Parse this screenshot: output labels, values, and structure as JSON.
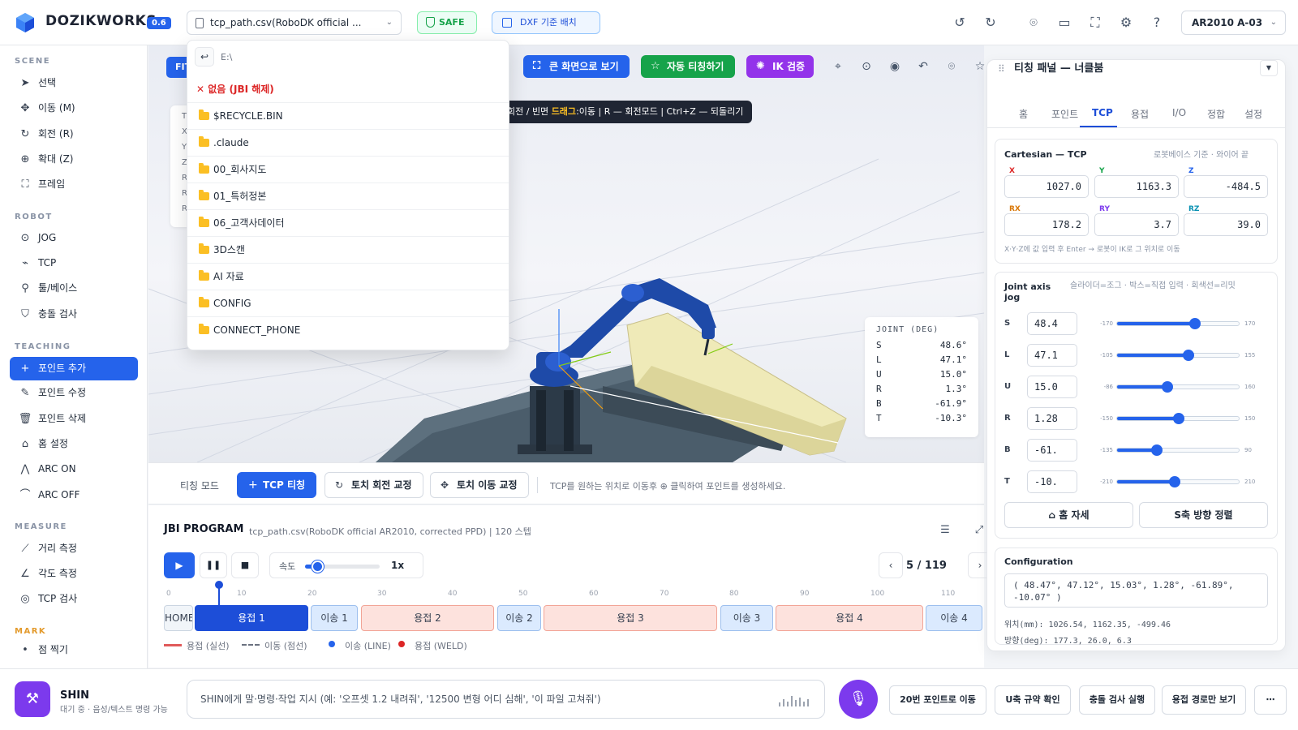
{
  "app": {
    "brand": "DOZIKWORKS",
    "version": "0.6"
  },
  "topbar": {
    "file_name": "tcp_path.csv(RoboDK official ...",
    "safe_label": "SAFE",
    "dxf_label": "DXF 기준 배치",
    "robot_model": "AR2010 A-03"
  },
  "sidebar": {
    "sections": {
      "scene": "SCENE",
      "robot": "ROBOT",
      "teaching": "TEACHING",
      "measure": "MEASURE",
      "mark": "MARK"
    },
    "scene": [
      {
        "label": "선택",
        "icon": "cursor-icon"
      },
      {
        "label": "이동 (M)",
        "icon": "move-icon"
      },
      {
        "label": "회전 (R)",
        "icon": "rotate-icon"
      },
      {
        "label": "확대 (Z)",
        "icon": "zoom-icon"
      },
      {
        "label": "프레임",
        "icon": "frame-icon"
      }
    ],
    "robot": [
      {
        "label": "JOG",
        "icon": "jog-icon"
      },
      {
        "label": "TCP",
        "icon": "tcp-icon"
      },
      {
        "label": "툴/베이스",
        "icon": "wrench-icon"
      },
      {
        "label": "충돌 검사",
        "icon": "shield-icon"
      }
    ],
    "teaching": [
      {
        "label": "포인트 추가",
        "icon": "plus-icon"
      },
      {
        "label": "포인트 수정",
        "icon": "edit-icon"
      },
      {
        "label": "포인트 삭제",
        "icon": "trash-icon"
      },
      {
        "label": "홈 설정",
        "icon": "home-icon"
      },
      {
        "label": "ARC ON",
        "icon": "arc-on-icon"
      },
      {
        "label": "ARC OFF",
        "icon": "arc-off-icon"
      }
    ],
    "measure": [
      {
        "label": "거리 측정",
        "icon": "ruler-icon"
      },
      {
        "label": "각도 측정",
        "icon": "angle-icon"
      },
      {
        "label": "TCP 검사",
        "icon": "target-icon"
      }
    ],
    "mark": [
      {
        "label": "점 찍기",
        "icon": "dot-icon"
      }
    ]
  },
  "viewport": {
    "fit_label": "FIT",
    "fullscreen_label": "큰 화면으로 보기",
    "auto_teach_label": "자동 티칭하기",
    "ik_label": "IK 검증",
    "hint_prefix": "회전 / 빈면 ",
    "hint_bold": "드래그",
    "hint_suffix": ":이동 | R — 회전모드 | Ctrl+Z — 되돌리기",
    "info_labels": [
      "T",
      "X",
      "Y",
      "Z",
      "R",
      "R",
      "R"
    ],
    "joint_title": "JOINT (DEG)",
    "joints": [
      {
        "axis": "S",
        "value": "48.6°"
      },
      {
        "axis": "L",
        "value": "47.1°"
      },
      {
        "axis": "U",
        "value": "15.0°"
      },
      {
        "axis": "R",
        "value": "1.3°"
      },
      {
        "axis": "B",
        "value": "-61.9°"
      },
      {
        "axis": "T",
        "value": "-10.3°"
      }
    ]
  },
  "teachbar": {
    "mode_label": "티칭 모드",
    "tcp_teach": "TCP 티칭",
    "torch_rot": "토치 회전 교정",
    "torch_move": "토치 이동 교정",
    "hint": "TCP를 원하는 위치로 이동후 ⊕ 클릭하여 포인트를 생성하세요."
  },
  "jbi": {
    "title": "JBI PROGRAM",
    "subtitle": "tcp_path.csv(RoboDK official AR2010, corrected PPD) | 120 스텝",
    "speed_label": "속도",
    "speed_value": "1x",
    "speed_fraction": 0.16,
    "page": "5 / 119",
    "ticks": [
      "0",
      "10",
      "20",
      "30",
      "40",
      "50",
      "60",
      "70",
      "80",
      "90",
      "100",
      "110"
    ],
    "segments": [
      {
        "label": "HOME",
        "kind": "home"
      },
      {
        "label": "용접 1",
        "kind": "weld-active"
      },
      {
        "label": "이송 1",
        "kind": "move"
      },
      {
        "label": "용접 2",
        "kind": "weld"
      },
      {
        "label": "이송 2",
        "kind": "move"
      },
      {
        "label": "용접 3",
        "kind": "weld"
      },
      {
        "label": "이송 3",
        "kind": "move"
      },
      {
        "label": "용접 4",
        "kind": "weld"
      },
      {
        "label": "이송 4",
        "kind": "move"
      }
    ],
    "legend": [
      {
        "label": "용접 (실선)",
        "color": "#e05a5a"
      },
      {
        "label": "이동 (점선)",
        "color": "#6b7280"
      },
      {
        "label": "이송 (LINE)",
        "color": "#2563eb"
      },
      {
        "label": "용접 (WELD)",
        "color": "#dc2626"
      }
    ]
  },
  "panel": {
    "title": "티칭 패널 — 너클붐",
    "tabs": [
      "홈",
      "포인트",
      "TCP",
      "용접",
      "I/O",
      "정합",
      "설정"
    ],
    "active_tab": "TCP",
    "cartesian": {
      "title": "Cartesian — TCP",
      "subtitle": "로봇베이스 기준 · 와이어 끝",
      "fields": [
        {
          "label": "X",
          "value": "1027.0",
          "color": "#dc2626"
        },
        {
          "label": "Y",
          "value": "1163.3",
          "color": "#16a34a"
        },
        {
          "label": "Z",
          "value": "-484.5",
          "color": "#2563eb"
        },
        {
          "label": "RX",
          "value": "178.2",
          "color": "#d97706"
        },
        {
          "label": "RY",
          "value": "3.7",
          "color": "#7c3aed"
        },
        {
          "label": "RZ",
          "value": "39.0",
          "color": "#0891b2"
        }
      ],
      "note": "X·Y·Z에 값 입력 후 Enter → 로봇이 IK로 그 위치로 이동"
    },
    "jog": {
      "title": "Joint axis jog",
      "hint": "슬라이더=조그 · 박스=직접 입력 · 회색선=리밋",
      "axes": [
        {
          "axis": "S",
          "value": "48.4",
          "min": "-170",
          "max": "170",
          "deg": 48.4,
          "lo": -170,
          "hi": 170
        },
        {
          "axis": "L",
          "value": "47.1",
          "min": "-105",
          "max": "155",
          "deg": 47.1,
          "lo": -105,
          "hi": 155
        },
        {
          "axis": "U",
          "value": "15.0",
          "min": "-86",
          "max": "160",
          "deg": 15.0,
          "lo": -86,
          "hi": 160
        },
        {
          "axis": "R",
          "value": "1.28",
          "min": "-150",
          "max": "150",
          "deg": 1.28,
          "lo": -150,
          "hi": 150
        },
        {
          "axis": "B",
          "value": "-61.",
          "min": "-135",
          "max": "90",
          "deg": -61.9,
          "lo": -135,
          "hi": 90
        },
        {
          "axis": "T",
          "value": "-10.",
          "min": "-210",
          "max": "210",
          "deg": -10.3,
          "lo": -210,
          "hi": 210
        }
      ],
      "home_btn": "홈 자세",
      "align_btn": "S축 방향 정렬"
    },
    "config": {
      "title": "Configuration",
      "values": "( 48.47°, 47.12°, 15.03°, 1.28°, -61.89°, -10.07° )",
      "position": "위치(mm): 1026.54, 1162.35, -499.46",
      "orientation": "방향(deg): 177.3, 26.0, 6.3"
    }
  },
  "filemenu": {
    "path": "E:\\",
    "none_label": "없음 (JBI 해제)",
    "folders": [
      "$RECYCLE.BIN",
      ".claude",
      "00_회사지도",
      "01_특허정본",
      "06_고객사데이터",
      "3D스캔",
      "AI 자료",
      "CONFIG",
      "CONNECT_PHONE"
    ]
  },
  "assistant": {
    "name": "SHIN",
    "status": "대기 중 · 음성/텍스트 명령 가능",
    "placeholder": "SHIN에게 말·명령·작업 지시 (예: '오프셋 1.2 내려줘', '12500 변형 어디 심해', '이 파일 고쳐줘')",
    "quick": [
      "20번 포인트로 이동",
      "U축 규약 확인",
      "충돌 검사 실행",
      "용접 경로만 보기",
      "⋯"
    ]
  }
}
